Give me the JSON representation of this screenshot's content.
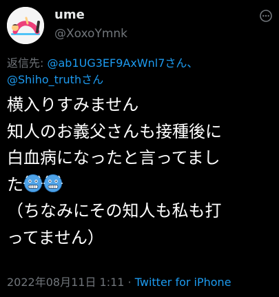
{
  "user": {
    "display_name": "ume",
    "handle": "@XoxoYmnk",
    "avatar_icon": "yoga-person-icon"
  },
  "reply": {
    "prefix": "返信先: ",
    "mention1": "@ab1UG3EF9AxWnl7さん、",
    "mention2": "@Shiho_truthさん"
  },
  "tweet": {
    "lines": [
      "横入りすみません",
      "知人のお義父さんも接種後に",
      "白血病になったと言ってまし",
      "た",
      "（ちなみにその知人も私も打",
      "ってません）"
    ],
    "emojis": [
      "cold-face-emoji",
      "cold-face-emoji"
    ]
  },
  "meta": {
    "timestamp": "2022年08月11日 1:11",
    "separator": " · ",
    "source": "Twitter for iPhone"
  },
  "colors": {
    "background": "#000000",
    "text": "#ffffff",
    "secondary": "#71767b",
    "link": "#1d9bf0"
  }
}
